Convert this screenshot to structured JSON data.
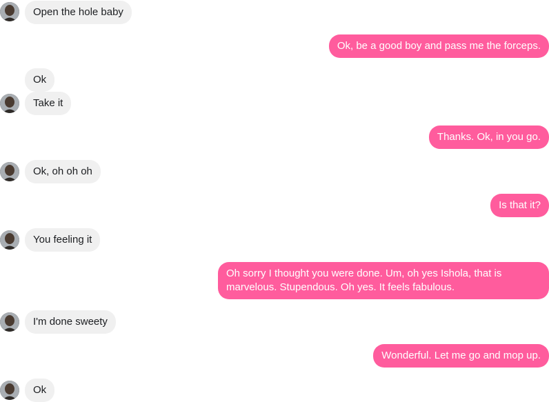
{
  "conversation": {
    "messages": [
      {
        "from": "them",
        "text": "Open the hole baby"
      },
      {
        "from": "me",
        "text": "Ok, be a good boy and pass me the forceps."
      },
      {
        "from": "them",
        "text": "Ok"
      },
      {
        "from": "them",
        "text": "Take it"
      },
      {
        "from": "me",
        "text": "Thanks. Ok, in you go."
      },
      {
        "from": "them",
        "text": "Ok, oh oh oh"
      },
      {
        "from": "me",
        "text": "Is that it?"
      },
      {
        "from": "them",
        "text": "You feeling it"
      },
      {
        "from": "me",
        "text": "Oh sorry I thought you were done. Um, oh yes Ishola, that is marvelous. Stupendous. Oh yes. It feels fabulous."
      },
      {
        "from": "them",
        "text": "I'm done sweety"
      },
      {
        "from": "me",
        "text": "Wonderful. Let me go and mop up."
      },
      {
        "from": "them",
        "text": "Ok"
      }
    ]
  },
  "colors": {
    "incoming_bubble": "#f0f0f0",
    "outgoing_bubble": "#ff5c9d",
    "outgoing_text": "#ffffff"
  },
  "icons": {
    "avatar": "contact-avatar"
  }
}
